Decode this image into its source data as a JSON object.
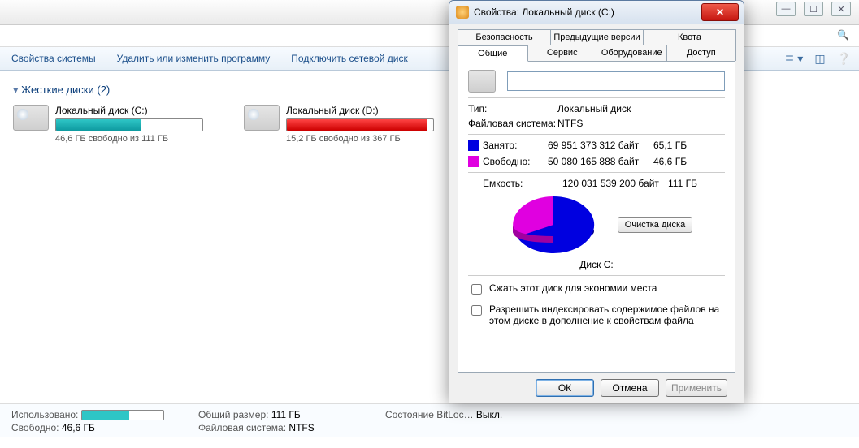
{
  "toolbar": {
    "system_props": "Свойства системы",
    "uninstall": "Удалить или изменить программу",
    "map_drive": "Подключить сетевой диск"
  },
  "section": {
    "title": "Жесткие диски (2)"
  },
  "drives": [
    {
      "name": "Локальный диск (C:)",
      "sub": "46,6 ГБ свободно из 111 ГБ"
    },
    {
      "name": "Локальный диск (D:)",
      "sub": "15,2 ГБ свободно из 367 ГБ"
    }
  ],
  "status": {
    "used_lbl": "Использовано:",
    "free_lbl": "Свободно:",
    "free_val": "46,6 ГБ",
    "total_lbl": "Общий размер:",
    "total_val": "111 ГБ",
    "fs_lbl": "Файловая система:",
    "fs_val": "NTFS",
    "bitlock_lbl": "Состояние BitLoc…",
    "bitlock_val": "Выкл."
  },
  "dialog": {
    "title": "Свойства: Локальный диск (C:)",
    "tabs_row1": [
      "Безопасность",
      "Предыдущие версии",
      "Квота"
    ],
    "tabs_row2": [
      "Общие",
      "Сервис",
      "Оборудование",
      "Доступ"
    ],
    "type_lbl": "Тип:",
    "type_val": "Локальный диск",
    "fs_lbl": "Файловая система:",
    "fs_val": "NTFS",
    "used_lbl": "Занято:",
    "used_bytes": "69 951 373 312 байт",
    "used_gb": "65,1 ГБ",
    "free_lbl": "Свободно:",
    "free_bytes": "50 080 165 888 байт",
    "free_gb": "46,6 ГБ",
    "cap_lbl": "Емкость:",
    "cap_bytes": "120 031 539 200 байт",
    "cap_gb": "111 ГБ",
    "pie_label": "Диск C:",
    "clean_btn": "Очистка диска",
    "chk_compress": "Сжать этот диск для экономии места",
    "chk_index": "Разрешить индексировать содержимое файлов на этом диске в дополнение к свойствам файла",
    "ok": "ОК",
    "cancel": "Отмена",
    "apply": "Применить"
  },
  "chart_data": {
    "type": "pie",
    "title": "Диск C:",
    "series": [
      {
        "name": "Занято",
        "value": 65.1,
        "color": "#0000e0"
      },
      {
        "name": "Свободно",
        "value": 46.6,
        "color": "#e000e0"
      }
    ],
    "unit": "ГБ"
  }
}
